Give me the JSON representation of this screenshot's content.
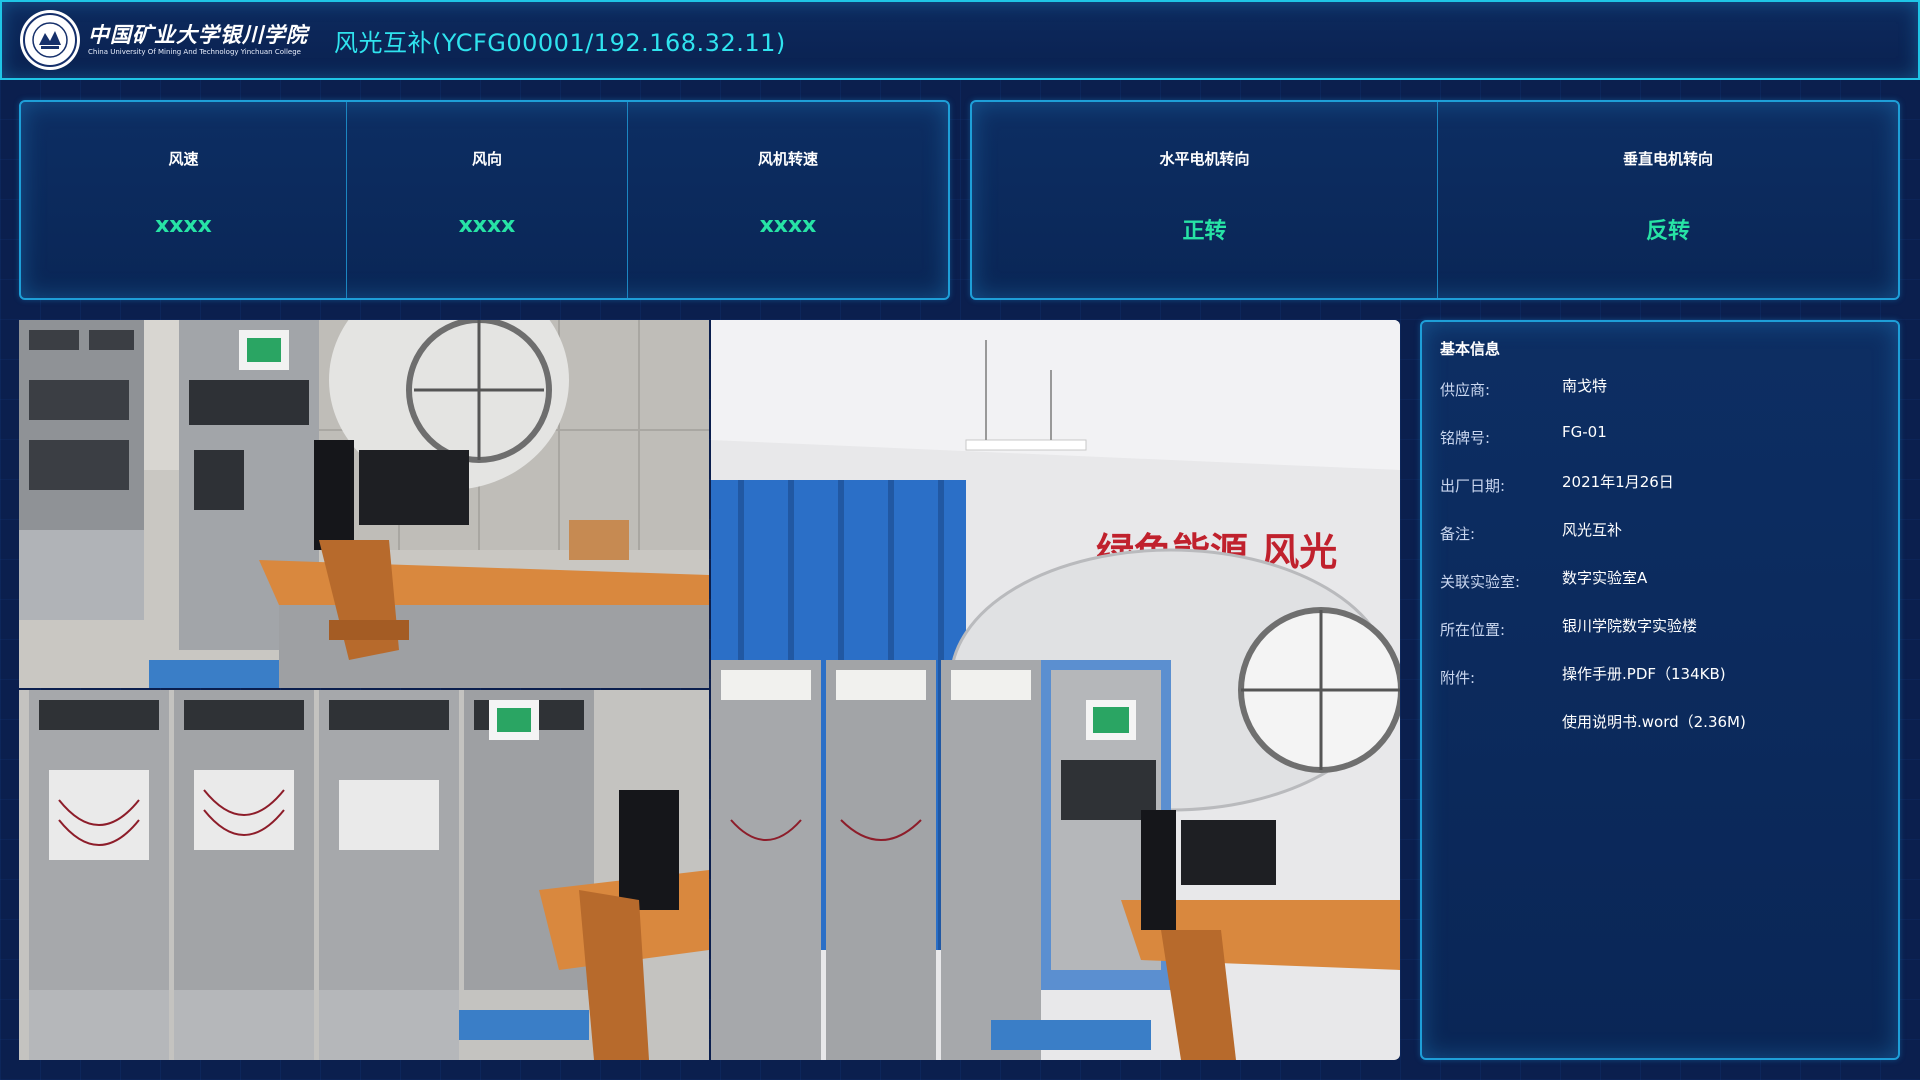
{
  "header": {
    "logo_cn": "中国矿业大学银川学院",
    "logo_en": "China University Of Mining And Technology Yinchuan College",
    "title": "风光互补(YCFG00001/192.168.32.11)"
  },
  "metrics_left": [
    {
      "label": "风速",
      "value": "xxxx"
    },
    {
      "label": "风向",
      "value": "xxxx"
    },
    {
      "label": "风机转速",
      "value": "xxxx"
    }
  ],
  "metrics_right": [
    {
      "label": "水平电机转向",
      "value": "正转"
    },
    {
      "label": "垂直电机转向",
      "value": "反转"
    }
  ],
  "photos": {
    "banner_text": "绿色能源 风光"
  },
  "info": {
    "title": "基本信息",
    "rows": [
      {
        "key": "供应商:",
        "value": "南戈特"
      },
      {
        "key": "铭牌号:",
        "value": "FG-01"
      },
      {
        "key": "出厂日期:",
        "value": "2021年1月26日"
      },
      {
        "key": "备注:",
        "value": "风光互补"
      },
      {
        "key": "关联实验室:",
        "value": "数字实验室A"
      },
      {
        "key": "所在位置:",
        "value": "银川学院数字实验楼"
      }
    ],
    "attachments_key": "附件:",
    "attachments": [
      "操作手册.PDF（134KB)",
      "使用说明书.word（2.36M)"
    ]
  },
  "colors": {
    "accent_cyan": "#2fe3ee",
    "value_green": "#27e3a5",
    "panel_border": "#1e9fd8",
    "background": "#0b1f4e"
  }
}
